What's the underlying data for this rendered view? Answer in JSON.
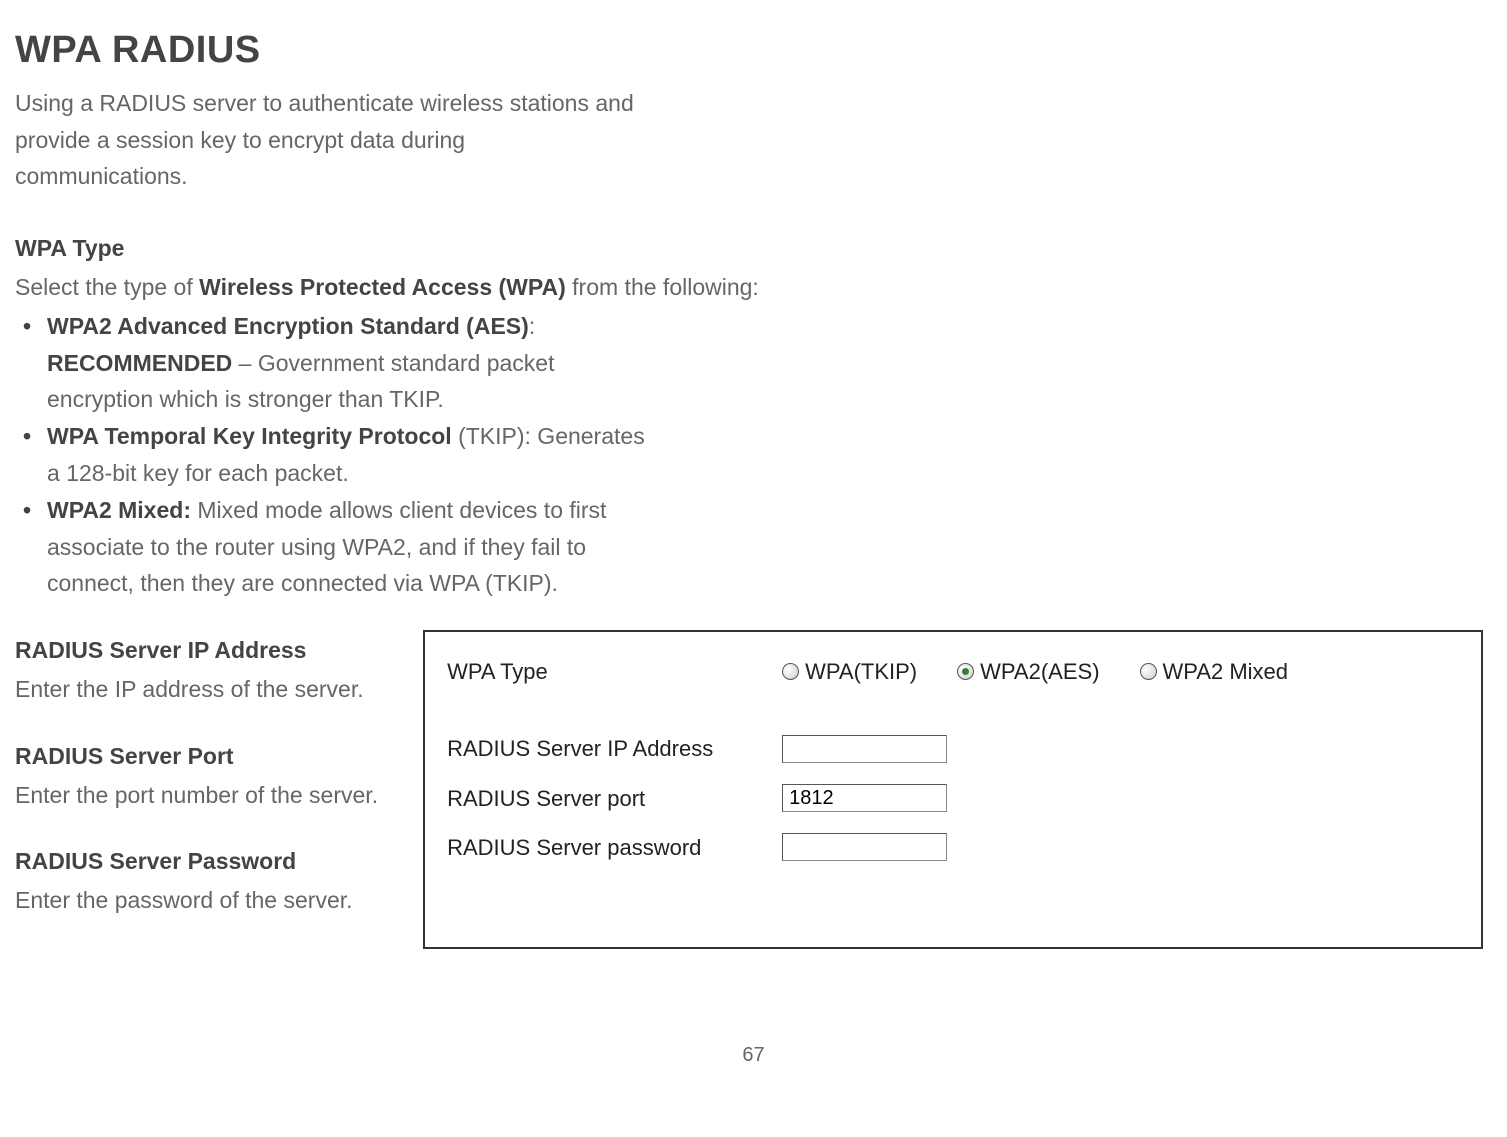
{
  "title": "WPA RADIUS",
  "intro": "Using a RADIUS server to authenticate wireless stations and provide a session key to encrypt data during communications.",
  "wpa_type": {
    "heading": "WPA Type",
    "text_prefix": "Select the type of ",
    "text_bold": "Wireless Protected Access (WPA)",
    "text_suffix": " from the following:",
    "bullets": {
      "b1_bold": "WPA2 Advanced Encryption Standard (AES)",
      "b1_colon": ": ",
      "b1_rec": "RECOMMENDED",
      "b1_rest": " – Government standard packet encryption which is stronger than TKIP.",
      "b2_bold": "WPA Temporal Key Integrity Protocol",
      "b2_rest": " (TKIP): Generates a 128-bit key for each packet.",
      "b3_bold": "WPA2 Mixed:",
      "b3_rest": " Mixed mode allows client devices to first associate to the router using WPA2, and if they fail to connect, then they are connected via WPA (TKIP)."
    }
  },
  "fields": {
    "ip": {
      "heading": "RADIUS Server IP Address",
      "desc": "Enter the IP address of the server."
    },
    "port": {
      "heading": "RADIUS Server Port",
      "desc": "Enter the port number of the server."
    },
    "password": {
      "heading": "RADIUS Server Password",
      "desc": "Enter the password of the server."
    }
  },
  "dialog": {
    "row1_label": "WPA Type",
    "radio1": "WPA(TKIP)",
    "radio2": "WPA2(AES)",
    "radio3": "WPA2 Mixed",
    "row2_label": "RADIUS Server IP Address",
    "row2_value": "",
    "row3_label": "RADIUS Server port",
    "row3_value": "1812",
    "row4_label": "RADIUS Server password",
    "row4_value": ""
  },
  "page_number": "67"
}
